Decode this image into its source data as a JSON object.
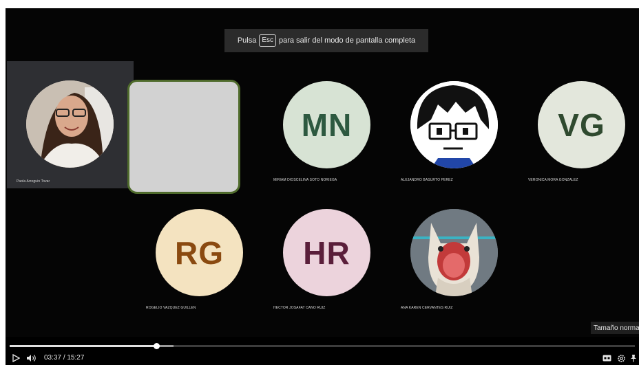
{
  "toast": {
    "before": "Pulsa",
    "key": "Esc",
    "after": "para salir del modo de pantalla completa"
  },
  "participants": [
    {
      "name": "Paola Arreguin Tovar",
      "type": "photo"
    },
    {
      "initials": "MN",
      "name": "MIRIAM DIOSCELINA SOTO NORIEGA",
      "bg": "#d7e3d4",
      "fg": "#2d5940"
    },
    {
      "name": "ALEJANDRO BASURTO PEREZ",
      "type": "avatar-drawing"
    },
    {
      "initials": "VG",
      "name": "VERONICA MORA GONZALEZ",
      "bg": "#e3e7dc",
      "fg": "#2f4a2f"
    },
    {
      "initials": "RG",
      "name": "ROGELIO VAZQUEZ GUILLEN",
      "bg": "#f4e3c0",
      "fg": "#8a4a10"
    },
    {
      "initials": "HR",
      "name": "HECTOR JOSAFAT CANO RUIZ",
      "bg": "#ecd3dc",
      "fg": "#5a1e3a"
    },
    {
      "name": "ANA KAREN CERVANTES RUIZ",
      "type": "cat-photo"
    }
  ],
  "player": {
    "current_time": "03:37",
    "separator": "/",
    "duration": "15:27",
    "progress_fraction": 0.2341,
    "buffered_fraction": 0.2617,
    "tooltip": "Tamaño normal",
    "icons": [
      "play-icon",
      "volume-icon",
      "captions-icon",
      "settings-icon",
      "pin-icon"
    ]
  },
  "colors": {
    "meeting_bg": "#050505",
    "active_border": "#4f6b2c"
  }
}
